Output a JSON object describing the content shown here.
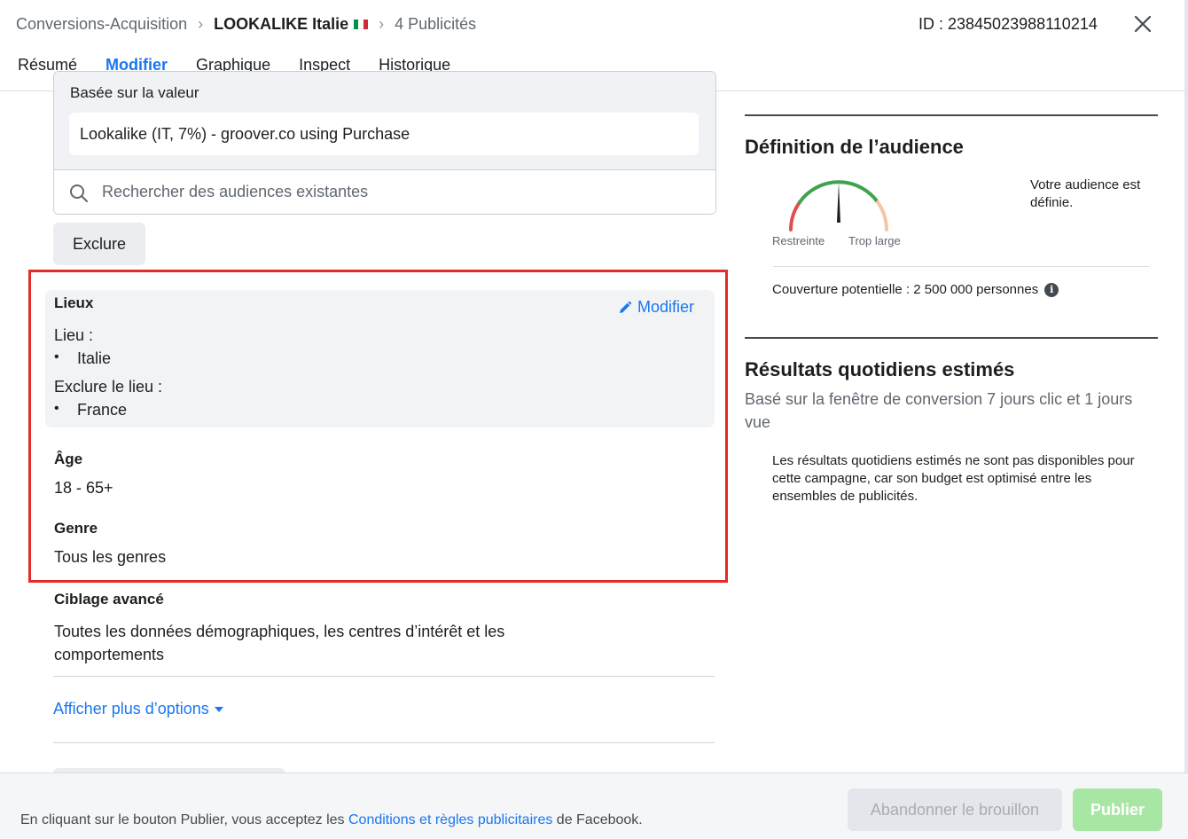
{
  "header": {
    "breadcrumb": {
      "campaign": "Conversions-Acquisition",
      "adset": "LOOKALIKE Italie",
      "ads": "4 Publicités"
    },
    "flag_colors": [
      "#009246",
      "#ffffff",
      "#ce2b37"
    ],
    "id_label": "ID : 23845023988110214",
    "close_icon": "close-icon"
  },
  "tabs": [
    {
      "label": "Résumé",
      "active": false
    },
    {
      "label": "Modifier",
      "active": true
    },
    {
      "label": "Graphique",
      "active": false
    },
    {
      "label": "Inspect",
      "active": false
    },
    {
      "label": "Historique",
      "active": false
    }
  ],
  "audience": {
    "sublabel": "Basée sur la valeur",
    "selected": "Lookalike (IT, 7%) - groover.co using Purchase",
    "search_placeholder": "Rechercher des audiences existantes",
    "exclude_label": "Exclure"
  },
  "locations": {
    "title": "Lieux",
    "modify_label": "Modifier",
    "include_label": "Lieu :",
    "include_items": [
      "Italie"
    ],
    "exclude_label": "Exclure le lieu :",
    "exclude_items": [
      "France"
    ]
  },
  "age": {
    "title": "Âge",
    "value": "18 - 65+"
  },
  "gender": {
    "title": "Genre",
    "value": "Tous les genres"
  },
  "advanced": {
    "title": "Ciblage avancé",
    "value_line1": "Toutes les données démographiques, les centres d’intérêt et les",
    "value_line2": "comportements"
  },
  "more_options_label": "Afficher plus d’options",
  "audience_definition": {
    "title": "Définition de l’audience",
    "gauge_left": "Restreinte",
    "gauge_right": "Trop large",
    "status": "Votre audience est définie.",
    "reach": "Couverture potentielle : 2 500 000 personnes",
    "gauge_colors": {
      "narrow": "#e04f4f",
      "good": "#3fa34d",
      "wide": "#f5c6a5"
    }
  },
  "daily_results": {
    "title": "Résultats quotidiens estimés",
    "subtitle": "Basé sur la fenêtre de conversion 7 jours clic et 1 jours vue",
    "note": "Les résultats quotidiens estimés ne sont pas disponibles pour cette campagne, car son budget est optimisé entre les ensembles de publicités."
  },
  "footer": {
    "text_before": "En cliquant sur le bouton Publier, vous acceptez les ",
    "link": "Conditions et règles publicitaires",
    "text_after": " de Facebook.",
    "discard_label": "Abandonner le brouillon",
    "publish_label": "Publier"
  }
}
